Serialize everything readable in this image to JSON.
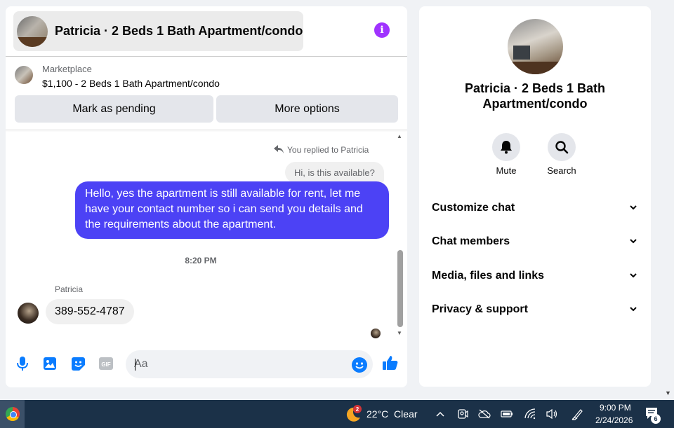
{
  "chat": {
    "title": "Patricia · 2 Beds 1 Bath Apartment/condo",
    "marketplace_label": "Marketplace",
    "listing": "$1,100 - 2 Beds 1 Bath Apartment/condo",
    "actions": {
      "pending": "Mark as pending",
      "more": "More options"
    },
    "messages": {
      "replied_label": "You replied to Patricia",
      "quoted": "Hi, is this available?",
      "outgoing": "Hello, yes the apartment is still available for rent, let me have your contact number so i can send you details and the requirements about the apartment.",
      "timestamp": "8:20 PM",
      "sender": "Patricia",
      "incoming": "389-552-4787"
    },
    "composer": {
      "placeholder": "Aa",
      "icons": [
        "microphone-icon",
        "image-icon",
        "sticker-icon",
        "gif-icon",
        "emoji-icon",
        "thumbs-up-icon"
      ]
    },
    "accent": "#4c42f5"
  },
  "info": {
    "name": "Patricia · 2 Beds 1 Bath Apartment/condo",
    "mute_label": "Mute",
    "search_label": "Search",
    "sections": [
      "Customize chat",
      "Chat members",
      "Media, files and links",
      "Privacy & support"
    ]
  },
  "taskbar": {
    "weather_badge": "2",
    "weather": "22°C  Clear",
    "time": "9:00 PM",
    "date": "2/24/2026",
    "notification_count": "6"
  }
}
